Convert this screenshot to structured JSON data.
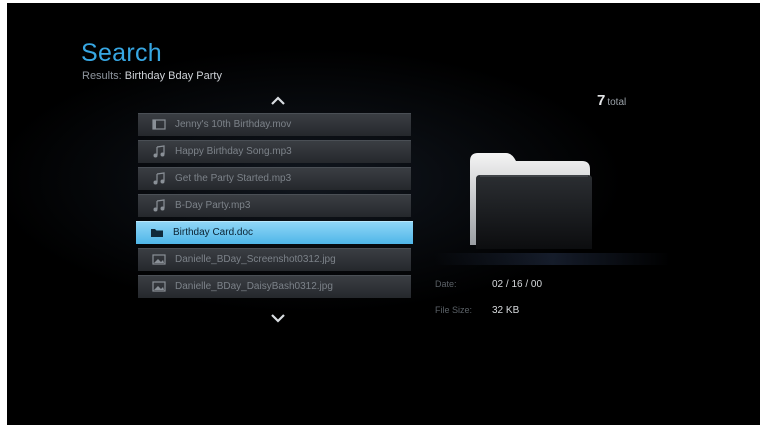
{
  "header": {
    "title": "Search",
    "results_label": "Results:",
    "query": "Birthday Bday Party"
  },
  "count": {
    "value": "7",
    "unit": "total"
  },
  "list": {
    "items": [
      {
        "label": "Jenny's 10th Birthday.mov",
        "icon": "video-icon",
        "selected": false
      },
      {
        "label": "Happy Birthday Song.mp3",
        "icon": "music-note-icon",
        "selected": false
      },
      {
        "label": "Get the Party Started.mp3",
        "icon": "music-note-icon",
        "selected": false
      },
      {
        "label": "B-Day Party.mp3",
        "icon": "music-note-icon",
        "selected": false
      },
      {
        "label": "Birthday Card.doc",
        "icon": "folder-icon",
        "selected": true
      },
      {
        "label": "Danielle_BDay_Screenshot0312.jpg",
        "icon": "image-icon",
        "selected": false
      },
      {
        "label": "Danielle_BDay_DaisyBash0312.jpg",
        "icon": "image-icon",
        "selected": false
      }
    ]
  },
  "details": {
    "date_label": "Date:",
    "date_value": "02 / 16 / 00",
    "size_label": "File Size:",
    "size_value": "32 KB"
  },
  "colors": {
    "accent": "#37a7e3",
    "selection": "#6cc6f0",
    "background": "#000000"
  }
}
